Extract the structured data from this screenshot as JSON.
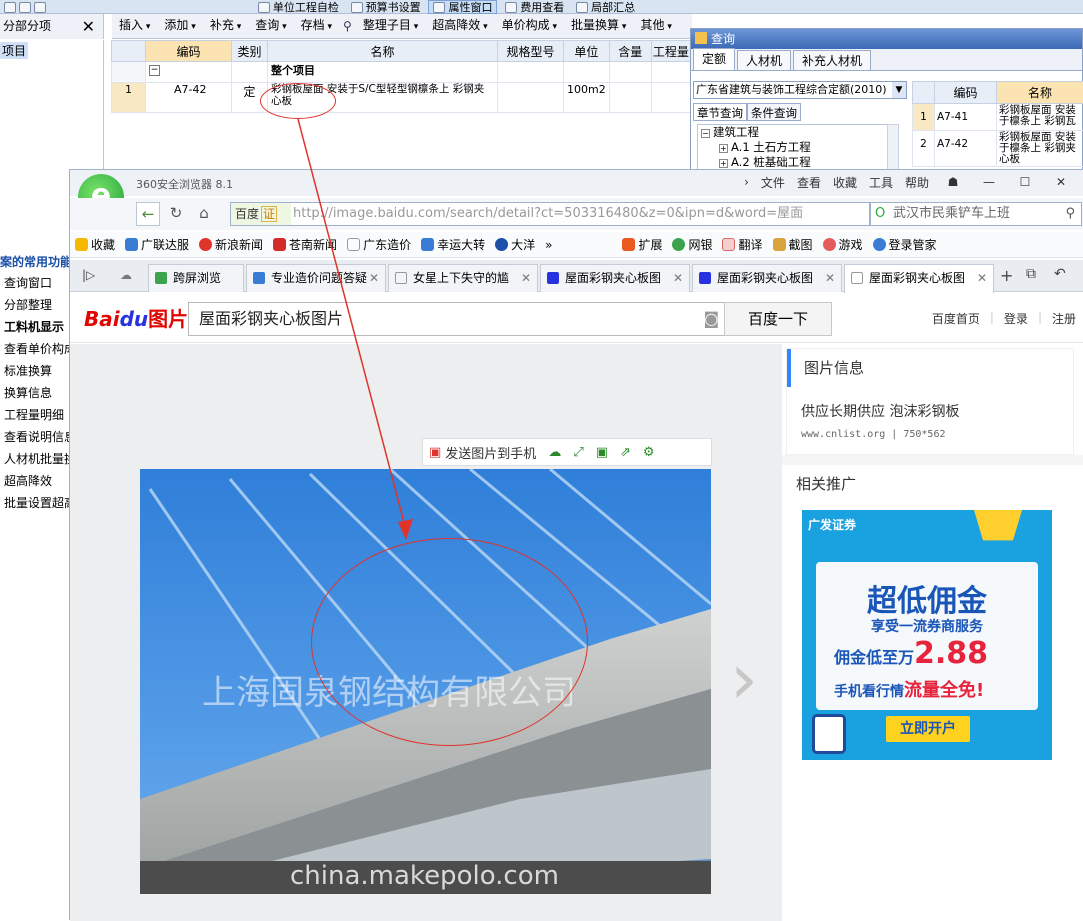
{
  "app": {
    "top_menu": [
      "单位工程自检",
      "预算书设置",
      "属性窗口",
      "费用查看",
      "局部汇总"
    ],
    "left_panel": {
      "title": "分部分项",
      "close": "✕",
      "root": "项目"
    },
    "toolbar": [
      "插入",
      "添加",
      "补充",
      "查询",
      "存档",
      "整理子目",
      "超高降效",
      "单价构成",
      "批量换算",
      "其他"
    ],
    "grid": {
      "headers": [
        "",
        "编码",
        "类别",
        "名称",
        "规格型号",
        "单位",
        "含量",
        "工程量"
      ],
      "group_row": {
        "sign": "−",
        "name": "整个项目"
      },
      "rows": [
        {
          "no": "1",
          "code": "A7-42",
          "type": "定",
          "name": "彩钢板屋面 安装于S/C型轻型钢檩条上 彩钢夹心板",
          "spec": "",
          "unit": "100m2",
          "qty": "",
          "amount": ""
        }
      ]
    },
    "common_functions": {
      "heading": "案的常用功能",
      "items": [
        "查询窗口",
        "分部整理",
        "工料机显示",
        "查看单价构成",
        "标准换算",
        "换算信息",
        "工程量明细",
        "查看说明信息",
        "人材机批量换",
        "超高降效",
        "批量设置超高"
      ]
    }
  },
  "query_window": {
    "title": "查询",
    "tabs": [
      "定额",
      "人材机",
      "补充人材机"
    ],
    "dropdown": "广东省建筑与装饰工程综合定额(2010)",
    "subtabs": [
      "章节查询",
      "条件查询"
    ],
    "tree": [
      {
        "sign": "−",
        "label": "建筑工程",
        "level": 0
      },
      {
        "sign": "+",
        "label": "A.1 土石方工程",
        "level": 1
      },
      {
        "sign": "+",
        "label": "A.2 桩基础工程",
        "level": 1
      }
    ],
    "grid_header": [
      "",
      "编码",
      "名称"
    ],
    "rows": [
      {
        "no": "1",
        "code": "A7-41",
        "name": "彩钢板屋面 安装于檩条上 彩钢瓦"
      },
      {
        "no": "2",
        "code": "A7-42",
        "name": "彩钢板屋面 安装于檩条上 彩钢夹心板"
      }
    ]
  },
  "browser": {
    "name": "360安全浏览器 8.1",
    "menu": [
      "文件",
      "查看",
      "收藏",
      "工具",
      "帮助"
    ],
    "badge": "百度",
    "badge_tag": "证",
    "url": "http://image.baidu.com/search/detail?ct=503316480&z=0&ipn=d&word=屋面",
    "search": "武汉市民乘铲车上班",
    "favorites": [
      "收藏",
      "广联达服",
      "新浪新闻",
      "苍南新闻",
      "广东造价",
      "幸运大转",
      "大洋",
      "扩展",
      "网银",
      "翻译",
      "截图",
      "游戏",
      "登录管家"
    ],
    "tabs": [
      "跨屏浏览",
      "专业造价问题答疑",
      "女星上下失守的尴",
      "屋面彩钢夹心板图",
      "屋面彩钢夹心板图",
      "屋面彩钢夹心板图"
    ],
    "colors": {
      "accent": "#3385ff",
      "brand_red": "#e10601",
      "brand_blue": "#2932e1",
      "green": "#4c8f36"
    }
  },
  "baidu": {
    "logo_left": "Bai",
    "logo_mid": "du",
    "logo_right": "图片",
    "query": "屋面彩钢夹心板图片",
    "button": "百度一下",
    "links": [
      "百度首页",
      "登录",
      "注册"
    ],
    "send_to_phone": "发送图片到手机",
    "image_watermark": "上海固泉钢结构有限公司",
    "image_footer": "china.makepolo.com",
    "info": {
      "heading": "图片信息",
      "title": "供应长期供应 泡沫彩钢板",
      "meta": "www.cnlist.org | 750*562"
    },
    "related": {
      "heading": "相关推广"
    },
    "ad": {
      "brand": "广发证券",
      "headline": "超低佣金",
      "sub": "享受一流券商服务",
      "price_pre": "佣金低至万",
      "price": "2.88",
      "line3_pre": "手机看行情",
      "line3": "流量全免!",
      "cta": "立即开户"
    }
  }
}
